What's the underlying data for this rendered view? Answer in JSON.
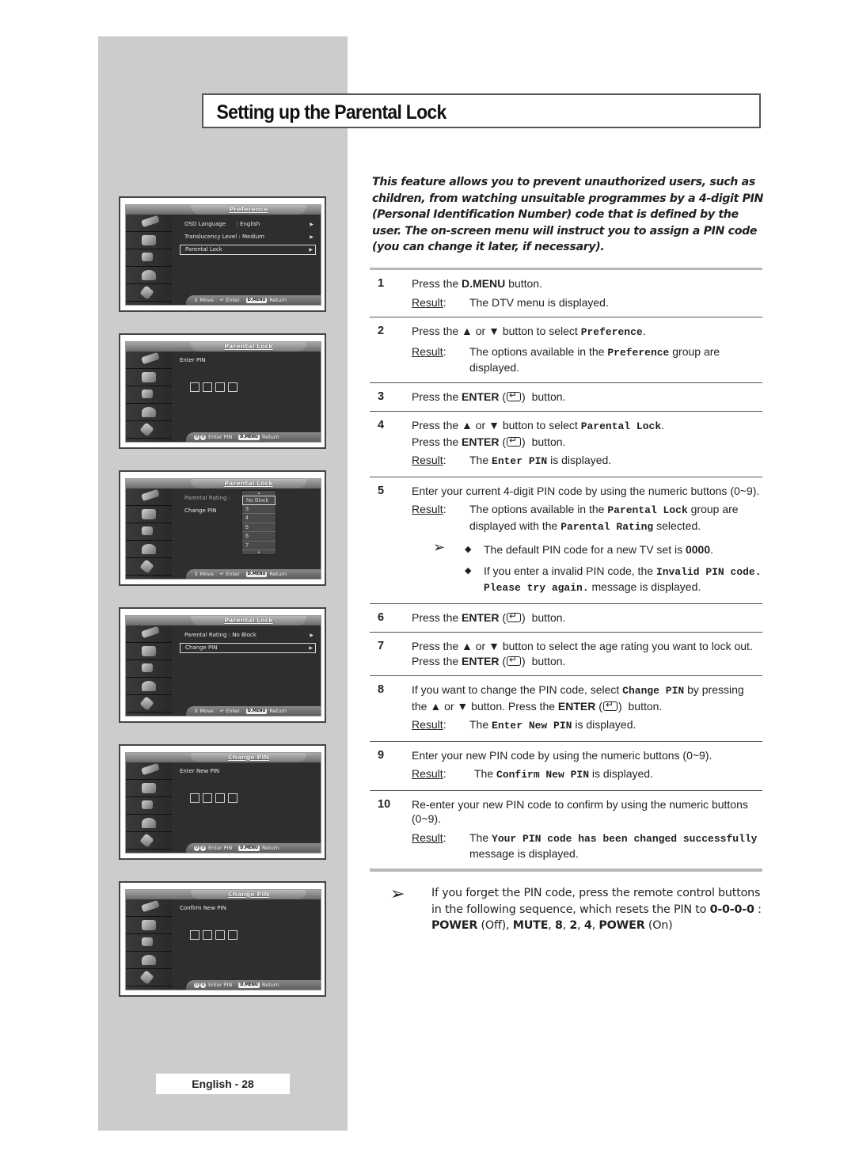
{
  "page": {
    "title": "Setting up the Parental Lock",
    "page_number": "English - 28"
  },
  "intro": "This feature allows you to prevent unauthorized users, such as children, from watching unsuitable programmes by a 4-digit PIN (Personal Identification Number) code that is defined by the user. The on-screen menu will instruct you to assign a PIN code (you can change it later, if necessary).",
  "common": {
    "result_label": "Result",
    "press_the": "Press the",
    "button": "button.",
    "enter_label": "ENTER",
    "or": "or",
    "up_glyph": "▲",
    "down_glyph": "▼"
  },
  "steps": [
    {
      "num": "1",
      "text_pre": "Press the ",
      "bold": "D.MENU",
      "text_post": " button.",
      "result": "The DTV menu is displayed."
    },
    {
      "num": "2",
      "text_pre": "Press the ▲ or ▼ button to select ",
      "code": "Preference",
      "text_post": ".",
      "result_pre": "The options available in the ",
      "result_code": "Preference",
      "result_post": " group are displayed."
    },
    {
      "num": "3",
      "text_pre": "Press the ",
      "bold": "ENTER",
      "text_post": " button."
    },
    {
      "num": "4",
      "line1_pre": "Press the ▲ or ▼ button to select ",
      "line1_code": "Parental Lock",
      "line1_post": ".",
      "line2_pre": "Press the ",
      "line2_bold": "ENTER",
      "line2_post": " button.",
      "result_pre": "The ",
      "result_code": "Enter PIN",
      "result_post": " is displayed."
    },
    {
      "num": "5",
      "text": "Enter your current 4-digit PIN code by using the numeric buttons (0~9).",
      "result_pre": "The options available in the ",
      "result_code": "Parental Lock",
      "result_mid": " group are displayed with the ",
      "result_code2": "Parental Rating",
      "result_post": " selected.",
      "notes": [
        {
          "pre": "The default PIN code for a new TV set is ",
          "bold": "0000",
          "post": "."
        },
        {
          "pre": "If you enter a invalid PIN code, the ",
          "code": "Invalid PIN code. Please try again.",
          "post": " message is displayed."
        }
      ]
    },
    {
      "num": "6",
      "text_pre": "Press the ",
      "bold": "ENTER",
      "text_post": " button."
    },
    {
      "num": "7",
      "text_pre": "Press the ▲ or ▼ button to select the age rating you want to lock out. Press the ",
      "bold": "ENTER",
      "text_post": " button."
    },
    {
      "num": "8",
      "text_pre": "If you want to change the PIN code, select ",
      "code": "Change PIN",
      "text_mid": " by pressing the ▲ or ▼ button. Press the ",
      "bold": "ENTER",
      "text_post": " button.",
      "result_pre": "The ",
      "result_code": "Enter New PIN",
      "result_post": " is displayed."
    },
    {
      "num": "9",
      "text": "Enter your new PIN code by using the numeric buttons (0~9).",
      "result_pre": "The ",
      "result_code": "Confirm New PIN",
      "result_post": " is displayed."
    },
    {
      "num": "10",
      "text": "Re-enter your new PIN code to confirm by using the numeric buttons (0~9).",
      "result_pre": "The ",
      "result_code": "Your PIN code has been changed successfully",
      "result_post": " message is displayed."
    }
  ],
  "tip": {
    "pre": "If you forget the PIN code, press the remote control buttons in the following sequence, which resets the PIN to ",
    "code_bold": "0-0-0-0",
    "sep": " : ",
    "seq": [
      {
        "bold": "POWER",
        "plain": " (Off), "
      },
      {
        "bold": "MUTE",
        "plain": ", "
      },
      {
        "bold": "8",
        "plain": ", "
      },
      {
        "bold": "2",
        "plain": ", "
      },
      {
        "bold": "4",
        "plain": ", "
      },
      {
        "bold": "POWER",
        "plain": " (On)"
      }
    ]
  },
  "screens": [
    {
      "title": "Preference",
      "rows": [
        {
          "label": "OSD Language      : English",
          "arrow": "▶",
          "selected": false
        },
        {
          "label": "Translucency Level : Medium",
          "arrow": "▶",
          "selected": false
        },
        {
          "label": "Parental Lock",
          "arrow": "▶",
          "selected": true
        }
      ],
      "footer": [
        {
          "icon": "⇕",
          "label": "Move"
        },
        {
          "icon": "↵",
          "label": "Enter"
        },
        {
          "badge": "D.MENU",
          "label": "Return"
        }
      ]
    },
    {
      "title": "Parental Lock",
      "prompt": "Enter PIN",
      "footer": [
        {
          "numbadge": [
            "0",
            "9"
          ],
          "label": "Enter PIN"
        },
        {
          "badge": "D.MENU",
          "label": "Return"
        }
      ]
    },
    {
      "title": "Parental Lock",
      "rows": [
        {
          "label": "Parental Rating :",
          "selected": false,
          "dim": true
        },
        {
          "label": "Change PIN",
          "selected": false
        }
      ],
      "dropdown": {
        "selected": "No Block",
        "options": [
          "3",
          "4",
          "5",
          "6",
          "7"
        ]
      },
      "footer": [
        {
          "icon": "⇕",
          "label": "Move"
        },
        {
          "icon": "↵",
          "label": "Enter"
        },
        {
          "badge": "D.MENU",
          "label": "Return"
        }
      ]
    },
    {
      "title": "Parental Lock",
      "rows": [
        {
          "label": "Parental Rating : No Block",
          "arrow": "▶",
          "selected": false
        },
        {
          "label": "Change PIN",
          "arrow": "▶",
          "selected": true
        }
      ],
      "footer": [
        {
          "icon": "⇕",
          "label": "Move"
        },
        {
          "icon": "↵",
          "label": "Enter"
        },
        {
          "badge": "D.MENU",
          "label": "Return"
        }
      ]
    },
    {
      "title": "Change PIN",
      "prompt": "Enter New PIN",
      "footer": [
        {
          "numbadge": [
            "0",
            "9"
          ],
          "label": "Enter PIN"
        },
        {
          "badge": "D.MENU",
          "label": "Return"
        }
      ]
    },
    {
      "title": "Change PIN",
      "prompt": "Confirm New PIN",
      "footer": [
        {
          "numbadge": [
            "0",
            "9"
          ],
          "label": "Enter PIN"
        },
        {
          "badge": "D.MENU",
          "label": "Return"
        }
      ]
    }
  ]
}
